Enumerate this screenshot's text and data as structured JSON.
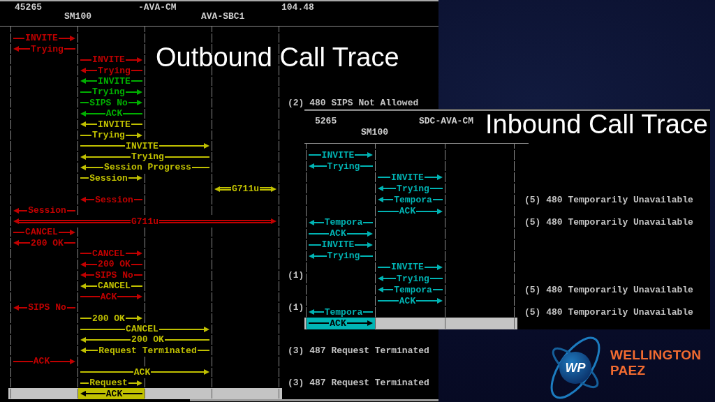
{
  "outbound": {
    "title": "Outbound Call Trace",
    "header_labels": [
      "45265",
      "SM100",
      "-AVA-CM",
      "AVA-SBC1",
      "104.48"
    ],
    "rows": [
      {
        "label": "INVITE",
        "kind": "first-to-second",
        "color": "#c00000",
        "selected": false
      },
      {
        "label": "Trying",
        "kind": "second-to-first",
        "color": "#c00000",
        "selected": false
      },
      {
        "label": "INVITE",
        "kind": "second-to-third",
        "color": "#c00000",
        "selected": false
      },
      {
        "label": "Trying",
        "kind": "third-to-second",
        "color": "#c00000",
        "selected": false
      },
      {
        "label": "INVITE",
        "kind": "third-to-second",
        "color": "#00b000",
        "selected": false
      },
      {
        "label": "Trying",
        "kind": "second-to-third",
        "color": "#00b000",
        "selected": false
      },
      {
        "label": "SIPS No",
        "kind": "second-to-third",
        "color": "#00b000",
        "selected": false,
        "note": "(2) 480 SIPS Not Allowed"
      },
      {
        "label": "ACK",
        "kind": "third-to-second",
        "color": "#00b000",
        "selected": false
      },
      {
        "label": "INVITE",
        "kind": "third-to-second",
        "color": "#c0c000",
        "selected": false
      },
      {
        "label": "Trying",
        "kind": "second-to-third",
        "color": "#c0c000",
        "selected": false
      },
      {
        "label": "INVITE",
        "kind": "second-to-fourth",
        "color": "#c0c000",
        "selected": false
      },
      {
        "label": "Trying",
        "kind": "fourth-to-second",
        "color": "#c0c000",
        "selected": false
      },
      {
        "label": "Session Progress",
        "kind": "fourth-to-second",
        "color": "#c0c000",
        "selected": false
      },
      {
        "label": "Session",
        "kind": "second-to-third",
        "color": "#c0c000",
        "selected": false
      },
      {
        "label": "G711u",
        "kind": "media-fourth-fifth",
        "color": "#c0c000",
        "selected": false
      },
      {
        "label": "Session",
        "kind": "third-to-second",
        "color": "#c00000",
        "selected": false
      },
      {
        "label": "Session",
        "kind": "second-to-first",
        "color": "#c00000",
        "selected": false
      },
      {
        "label": "G711u",
        "kind": "media-first-fifth",
        "color": "#c00000",
        "selected": false
      },
      {
        "label": "CANCEL",
        "kind": "first-to-second",
        "color": "#c00000",
        "selected": false
      },
      {
        "label": "200 OK",
        "kind": "second-to-first",
        "color": "#c00000",
        "selected": false
      },
      {
        "label": "CANCEL",
        "kind": "second-to-third",
        "color": "#c00000",
        "selected": false
      },
      {
        "label": "200 OK",
        "kind": "third-to-second",
        "color": "#c00000",
        "selected": false
      },
      {
        "label": "SIPS No",
        "kind": "third-to-second",
        "color": "#c00000",
        "selected": false,
        "note": "(1)"
      },
      {
        "label": "CANCEL",
        "kind": "third-to-second",
        "color": "#c0c000",
        "selected": false
      },
      {
        "label": "ACK",
        "kind": "second-to-third",
        "color": "#c00000",
        "selected": false
      },
      {
        "label": "SIPS No",
        "kind": "second-to-first",
        "color": "#c00000",
        "selected": false,
        "note": "(1)"
      },
      {
        "label": "200 OK",
        "kind": "second-to-third",
        "color": "#c0c000",
        "selected": false
      },
      {
        "label": "CANCEL",
        "kind": "second-to-fourth",
        "color": "#c0c000",
        "selected": false
      },
      {
        "label": "200 OK",
        "kind": "fourth-to-second",
        "color": "#c0c000",
        "selected": false
      },
      {
        "label": "Request Terminated",
        "kind": "fourth-to-second",
        "color": "#c0c000",
        "selected": false,
        "note": "(3) 487 Request Terminated"
      },
      {
        "label": "ACK",
        "kind": "first-to-second",
        "color": "#c00000",
        "selected": false
      },
      {
        "label": "ACK",
        "kind": "second-to-fourth",
        "color": "#c0c000",
        "selected": false
      },
      {
        "label": "Request",
        "kind": "second-to-third",
        "color": "#c0c000",
        "selected": false,
        "note": "(3) 487 Request Terminated"
      },
      {
        "label": "ACK",
        "kind": "third-to-second",
        "color": "#c0c000",
        "selected": true
      }
    ]
  },
  "inbound": {
    "title": "Inbound Call Trace",
    "header_labels": [
      "5265",
      "SM100",
      "SDC-AVA-CM"
    ],
    "rows": [
      {
        "label": "INVITE",
        "kind": "first-to-second",
        "color": "#00b4b4",
        "selected": false
      },
      {
        "label": "Trying",
        "kind": "second-to-first",
        "color": "#00b4b4",
        "selected": false
      },
      {
        "label": "INVITE",
        "kind": "second-to-third",
        "color": "#00b4b4",
        "selected": false
      },
      {
        "label": "Trying",
        "kind": "third-to-second",
        "color": "#00b4b4",
        "selected": false
      },
      {
        "label": "Tempora",
        "kind": "third-to-second",
        "color": "#00b4b4",
        "selected": false,
        "note": "(5) 480 Temporarily Unavailable"
      },
      {
        "label": "ACK",
        "kind": "second-to-third",
        "color": "#00b4b4",
        "selected": false
      },
      {
        "label": "Tempora",
        "kind": "second-to-first",
        "color": "#00b4b4",
        "selected": false,
        "note": "(5) 480 Temporarily Unavailable"
      },
      {
        "label": "ACK",
        "kind": "first-to-second",
        "color": "#00b4b4",
        "selected": false
      },
      {
        "label": "INVITE",
        "kind": "first-to-second",
        "color": "#00b4b4",
        "selected": false
      },
      {
        "label": "Trying",
        "kind": "second-to-first",
        "color": "#00b4b4",
        "selected": false
      },
      {
        "label": "INVITE",
        "kind": "second-to-third",
        "color": "#00b4b4",
        "selected": false
      },
      {
        "label": "Trying",
        "kind": "third-to-second",
        "color": "#00b4b4",
        "selected": false
      },
      {
        "label": "Tempora",
        "kind": "third-to-second",
        "color": "#00b4b4",
        "selected": false,
        "note": "(5) 480 Temporarily Unavailable"
      },
      {
        "label": "ACK",
        "kind": "second-to-third",
        "color": "#00b4b4",
        "selected": false
      },
      {
        "label": "Tempora",
        "kind": "second-to-first",
        "color": "#00b4b4",
        "selected": false,
        "note": "(5) 480 Temporarily Unavailable"
      },
      {
        "label": "ACK",
        "kind": "first-to-second",
        "color": "#00b4b4",
        "selected": true
      }
    ]
  },
  "brand": {
    "monogram": "WP",
    "name": "WELLINGTON PAEZ"
  }
}
